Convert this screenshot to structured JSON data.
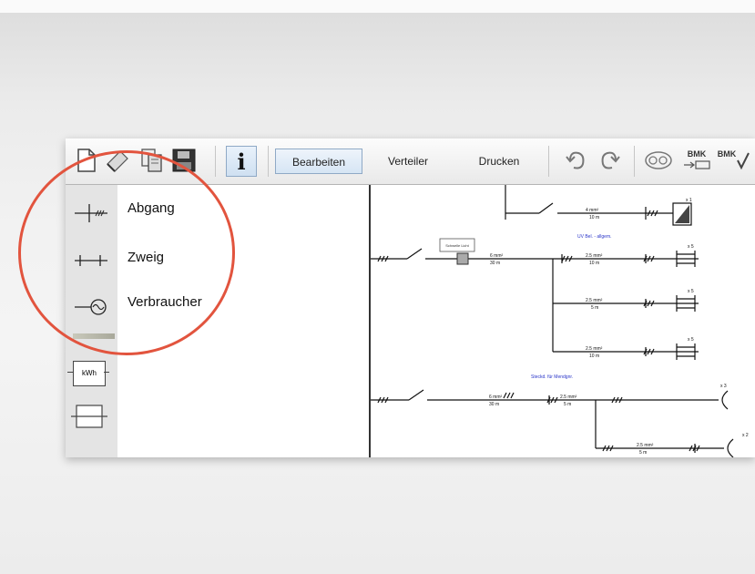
{
  "toolbar": {
    "icons": [
      "new-document-icon",
      "clear-icon",
      "copy-icon",
      "save-icon",
      "info-icon",
      "undo-icon",
      "redo-icon",
      "overview-icon",
      "bmk-export-icon",
      "bmk-check-icon"
    ],
    "info_label": "i",
    "tabs": [
      {
        "label": "Bearbeiten",
        "active": true
      },
      {
        "label": "Verteiler",
        "active": false
      },
      {
        "label": "Drucken",
        "active": false
      }
    ],
    "bmk_label": "BMK"
  },
  "palette": {
    "items": [
      {
        "label": "Abgang",
        "icon": "abgang-symbol-icon"
      },
      {
        "label": "Zweig",
        "icon": "zweig-symbol-icon"
      },
      {
        "label": "Verbraucher",
        "icon": "verbraucher-symbol-icon"
      }
    ],
    "meter_label": "kWh"
  },
  "schematic": {
    "group1_label": "UV Bel. - allgem.",
    "group2_label": "Steckd. für Mendgnr.",
    "box_label": "Schwelle Licht",
    "cable_main_top": "4 mm²",
    "len_main_top": "10 m",
    "cable_uv": "6 mm²",
    "len_uv": "30 m",
    "cable_branch": "2.5 mm²",
    "len_branch_a": "10 m",
    "len_branch_b": "5 m",
    "cable_st": "6 mm²",
    "len_st": "30 m",
    "mult_1": "x 1",
    "mult_5a": "x 5",
    "mult_5b": "x 5",
    "mult_5c": "x 5",
    "mult_3": "x 3",
    "mult_2": "x 2"
  },
  "colors": {
    "accent": "#e2543e",
    "annotation_blue": "#2a35c9",
    "active_tab": "#d6e5f4"
  }
}
